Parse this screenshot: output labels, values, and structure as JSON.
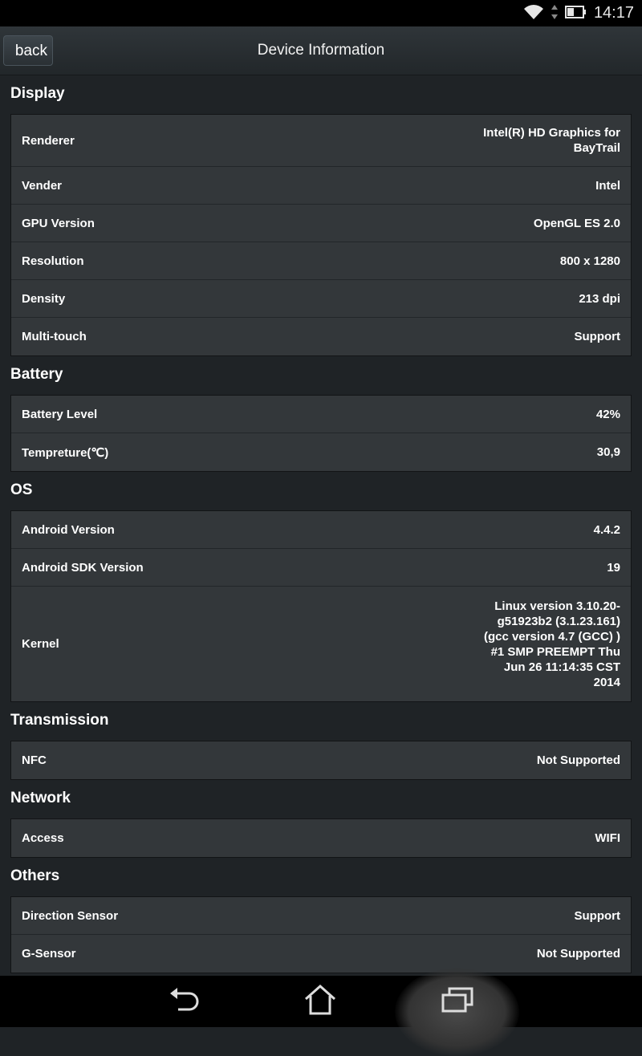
{
  "status_bar": {
    "time": "14:17"
  },
  "header": {
    "back_label": "back",
    "title": "Device Information"
  },
  "sections": [
    {
      "title": "Display",
      "rows": [
        {
          "label": "Renderer",
          "value": "Intel(R) HD Graphics for\nBayTrail"
        },
        {
          "label": "Vender",
          "value": "Intel"
        },
        {
          "label": "GPU Version",
          "value": "OpenGL ES 2.0"
        },
        {
          "label": "Resolution",
          "value": "800 x 1280"
        },
        {
          "label": "Density",
          "value": "213 dpi"
        },
        {
          "label": "Multi-touch",
          "value": "Support"
        }
      ]
    },
    {
      "title": "Battery",
      "rows": [
        {
          "label": "Battery Level",
          "value": "42%"
        },
        {
          "label": "Tempreture(℃)",
          "value": "30,9"
        }
      ]
    },
    {
      "title": "OS",
      "rows": [
        {
          "label": "Android Version",
          "value": "4.4.2"
        },
        {
          "label": "Android SDK Version",
          "value": "19"
        },
        {
          "label": "Kernel",
          "value": "Linux version 3.10.20-\ng51923b2 (3.1.23.161)\n(gcc version 4.7 (GCC) )\n#1 SMP PREEMPT Thu\nJun 26 11:14:35 CST\n2014"
        }
      ]
    },
    {
      "title": "Transmission",
      "rows": [
        {
          "label": "NFC",
          "value": "Not Supported"
        }
      ]
    },
    {
      "title": "Network",
      "rows": [
        {
          "label": "Access",
          "value": "WIFI"
        }
      ]
    },
    {
      "title": "Others",
      "rows": [
        {
          "label": "Direction Sensor",
          "value": "Support"
        },
        {
          "label": "G-Sensor",
          "value": "Not Supported"
        }
      ]
    }
  ]
}
